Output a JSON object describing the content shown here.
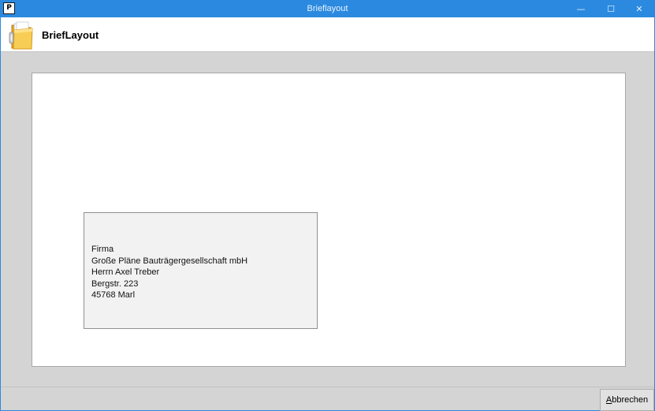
{
  "window": {
    "title": "Brieflayout",
    "app_icon_text": "P",
    "controls": {
      "minimize": "—",
      "maximize": "☐",
      "close": "✕"
    }
  },
  "header": {
    "title": "BriefLayout",
    "icon": "folder-icon"
  },
  "letter": {
    "address_lines": [
      "Firma",
      "Große Pläne Bauträgergesellschaft mbH",
      "Herrn Axel Treber",
      "Bergstr. 223",
      "45768 Marl"
    ]
  },
  "footer": {
    "cancel_accesskey": "A",
    "cancel_rest": "bbrechen"
  },
  "colors": {
    "titlebar": "#2b8ae0",
    "background": "#d4d4d4",
    "paper": "#ffffff",
    "address_window": "#f2f2f2"
  }
}
